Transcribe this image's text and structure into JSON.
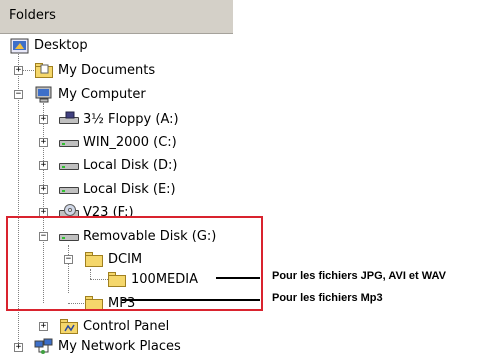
{
  "header": {
    "title": "Folders"
  },
  "tree": {
    "desktop": "Desktop",
    "my_documents": "My Documents",
    "my_computer": "My Computer",
    "floppy": "3½ Floppy (A:)",
    "win2000": "WIN_2000 (C:)",
    "local_d": "Local Disk (D:)",
    "local_e": "Local Disk (E:)",
    "v23": "V23 (F:)",
    "removable": "Removable Disk (G:)",
    "dcim": "DCIM",
    "media100": "100MEDIA",
    "mp3": "MP3",
    "control_panel": "Control Panel",
    "network": "My Network Places"
  },
  "annotations": {
    "jpg": "Pour les fichiers JPG, AVI et WAV",
    "mp3": "Pour les fichiers Mp3"
  },
  "colors": {
    "highlight": "#d9232e",
    "folder": "#f5d76b",
    "header": "#d4d0c8"
  }
}
